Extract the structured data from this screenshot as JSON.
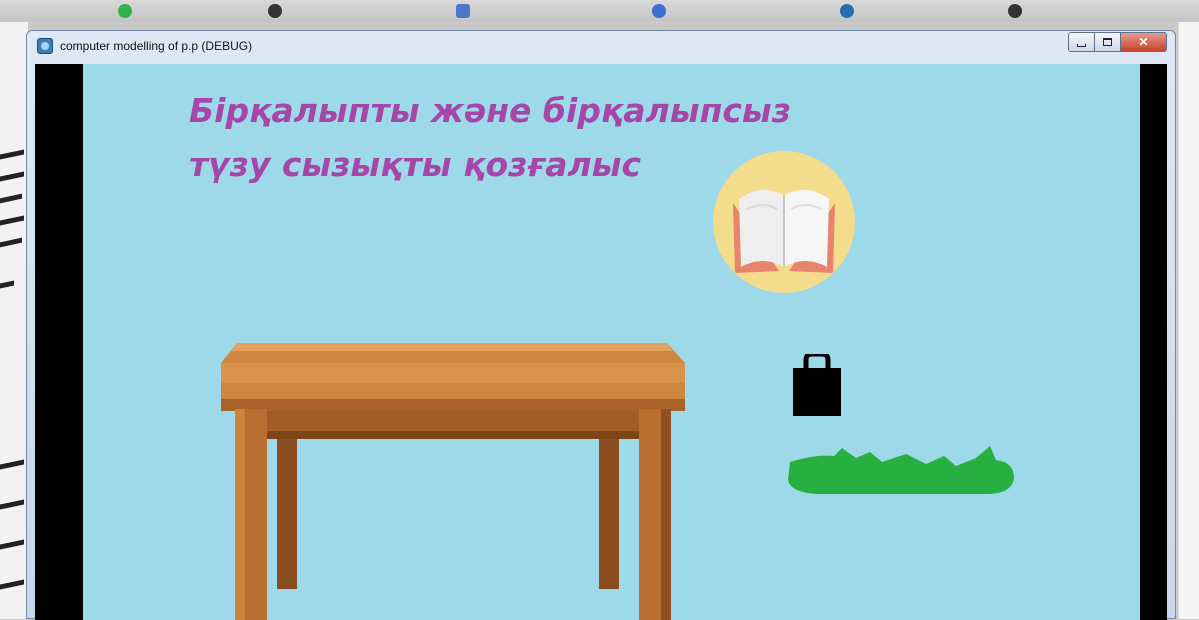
{
  "window": {
    "title": "computer modelling of p.p (DEBUG)",
    "minimize_label": "minimize",
    "maximize_label": "maximize",
    "close_symbol": "✕"
  },
  "scene": {
    "heading_line1": "Бірқалыпты және бірқалыпсыз",
    "heading_line2": "түзу сызықты қозғалыс",
    "heading_color": "#a646a9",
    "background_color": "#9dd9e9",
    "sprites": [
      "book-icon",
      "table-sprite",
      "bag-icon",
      "grass-platform"
    ]
  },
  "colors": {
    "book_badge": "#f3dc8c",
    "table_wood": "#c47a37",
    "grass": "#27b040",
    "bag": "#000000"
  }
}
